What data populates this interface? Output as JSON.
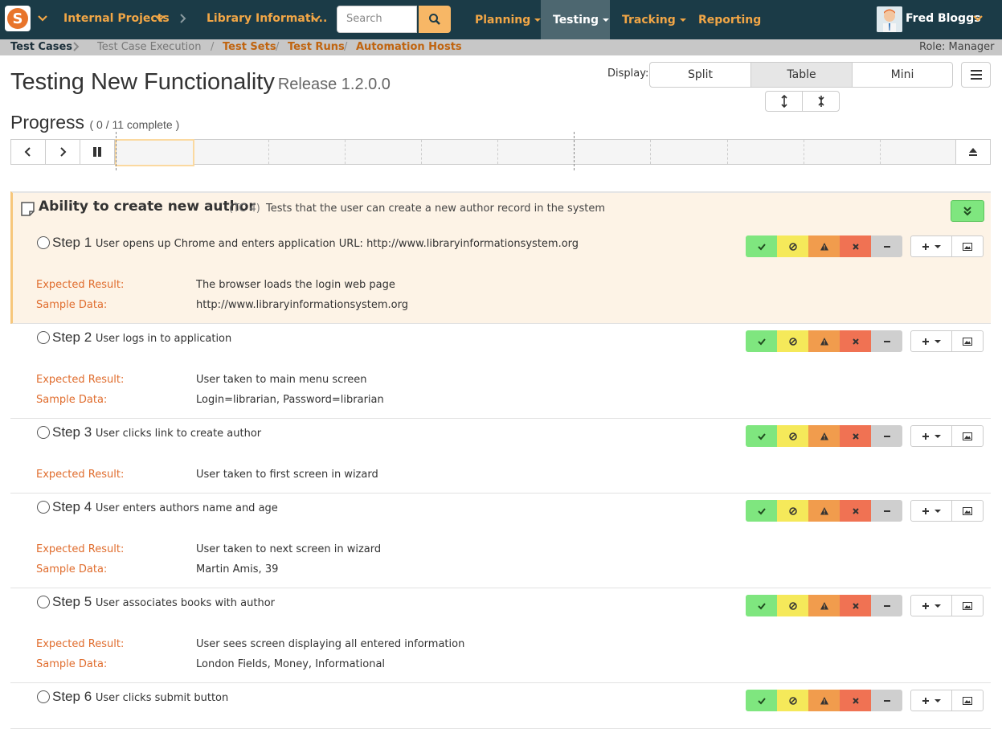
{
  "nav": {
    "project_group": "Internal Projects",
    "project": "Library Informati...",
    "search_placeholder": "Search",
    "menus": [
      "Planning",
      "Testing",
      "Tracking",
      "Reporting"
    ],
    "user": "Fred Bloggs"
  },
  "breadcrumb": {
    "items": [
      "Test Cases",
      "Test Case Execution",
      "Test Sets",
      "Test Runs",
      "Automation Hosts"
    ],
    "sep": "/",
    "role": "Role: Manager"
  },
  "page": {
    "title": "Testing New Functionality",
    "release": "Release 1.2.0.0",
    "display_label": "Display:",
    "display_options": [
      "Split",
      "Table",
      "Mini"
    ],
    "display_selected": "Table"
  },
  "progress": {
    "label": "Progress",
    "open": "(",
    "done": "0",
    "slash": "/",
    "total": "11 complete",
    "close": ")"
  },
  "test_case": {
    "name": "Ability to create new author",
    "id": "(TC 4)",
    "description": "Tests that the user can create a new author record in the system"
  },
  "labels": {
    "expected": "Expected Result:",
    "sample": "Sample Data:"
  },
  "steps": [
    {
      "num": "Step 1",
      "desc": "User opens up Chrome and enters application URL: http://www.libraryinformationsystem.org",
      "expected": "The browser loads the login web page",
      "sample": "http://www.libraryinformationsystem.org"
    },
    {
      "num": "Step 2",
      "desc": "User logs in to application",
      "expected": "User taken to main menu screen",
      "sample": "Login=librarian, Password=librarian"
    },
    {
      "num": "Step 3",
      "desc": "User clicks link to create author",
      "expected": "User taken to first screen in wizard",
      "sample": ""
    },
    {
      "num": "Step 4",
      "desc": "User enters authors name and age",
      "expected": "User taken to next screen in wizard",
      "sample": "Martin Amis, 39"
    },
    {
      "num": "Step 5",
      "desc": "User associates books with author",
      "expected": "User sees screen displaying all entered information",
      "sample": "London Fields, Money, Informational"
    },
    {
      "num": "Step 6",
      "desc": "User clicks submit button",
      "expected": "",
      "sample": ""
    }
  ],
  "icons": {
    "pass": "check-icon",
    "blocked": "blocked-icon",
    "caution": "warning-icon",
    "fail": "x-icon",
    "na": "minus-icon"
  },
  "colors": {
    "nav_bg": "#1b3b47",
    "accent": "#f1a646",
    "pass": "#7fe67f",
    "blocked": "#f5e95a",
    "caution": "#f19c4d",
    "fail": "#f07253",
    "na": "#cfcfcf",
    "label": "#e06d2e"
  }
}
